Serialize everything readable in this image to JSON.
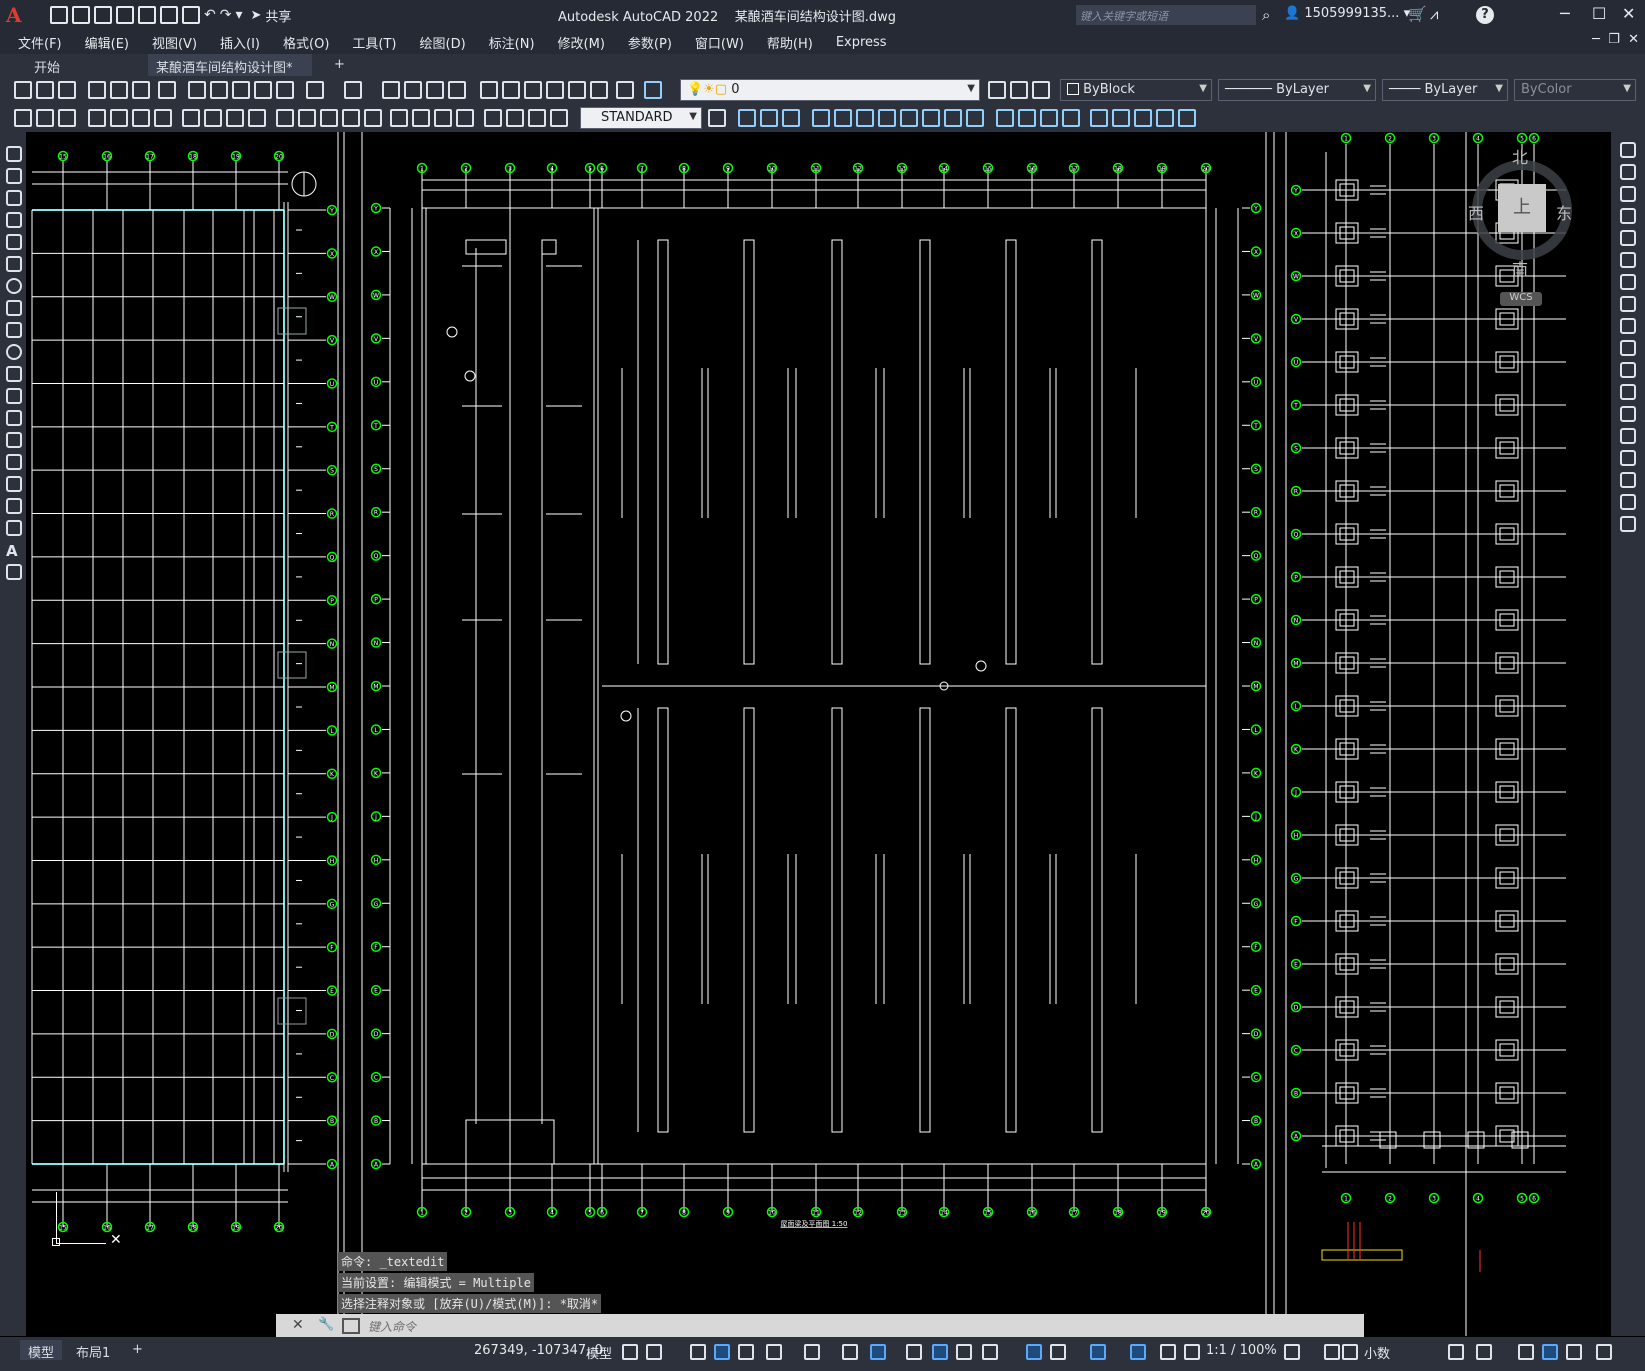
{
  "app": {
    "title": "Autodesk AutoCAD 2022",
    "file": "某酿酒车间结构设计图.dwg",
    "logo": "A",
    "share_label": "共享",
    "search_placeholder": "键入关键字或短语",
    "user": "1505999135...",
    "help": "?"
  },
  "menu": [
    "文件(F)",
    "编辑(E)",
    "视图(V)",
    "插入(I)",
    "格式(O)",
    "工具(T)",
    "绘图(D)",
    "标注(N)",
    "修改(M)",
    "参数(P)",
    "窗口(W)",
    "帮助(H)",
    "Express"
  ],
  "tabs": {
    "start": "开始",
    "drawing": "某酿酒车间结构设计图*",
    "close": "✕",
    "add": "+"
  },
  "toolbar": {
    "layer_value": "0",
    "color_value": "ByBlock",
    "linetype_value": "ByLayer",
    "lineweight_value": "ByLayer",
    "plotstyle_value": "ByColor",
    "textstyle_value": "STANDARD"
  },
  "viewcube": {
    "north": "北",
    "south": "南",
    "west": "西",
    "east": "东",
    "top": "上",
    "wcs": "WCS"
  },
  "drawing": {
    "caption": "屋面梁及平面图 1:50",
    "row_labels": [
      "Y",
      "X",
      "W",
      "V",
      "U",
      "T",
      "S",
      "R",
      "Q",
      "P",
      "N",
      "M",
      "L",
      "K",
      "J",
      "H",
      "G",
      "F",
      "E",
      "D",
      "C",
      "B",
      "A"
    ],
    "col_labels_mid": [
      "1",
      "2",
      "3",
      "4",
      "5",
      "6",
      "7",
      "8",
      "9",
      "10",
      "11",
      "12",
      "13",
      "14",
      "15",
      "16",
      "17",
      "18",
      "19",
      "20"
    ],
    "col_labels_left": [
      "15",
      "16",
      "17",
      "18",
      "19",
      "20"
    ],
    "col_labels_right": [
      "1",
      "2",
      "3",
      "4",
      "5",
      "6"
    ]
  },
  "command": {
    "history": [
      "命令: _textedit",
      "当前设置: 编辑模式 = Multiple",
      "选择注释对象或 [放弃(U)/模式(M)]: *取消*"
    ],
    "placeholder": "键入命令"
  },
  "status": {
    "model_tab": "模型",
    "layout_tab": "布局1",
    "add_tab": "+",
    "coords": "267349, -107347, 0",
    "space": "模型",
    "scale": "1:1 / 100%",
    "units": "小数"
  },
  "colors": {
    "background": "#000000",
    "chrome": "#2c313c",
    "titlebar": "#252a35",
    "bubble": "#00ff00",
    "line": "#ffffff",
    "highlight": "#00cccc"
  }
}
